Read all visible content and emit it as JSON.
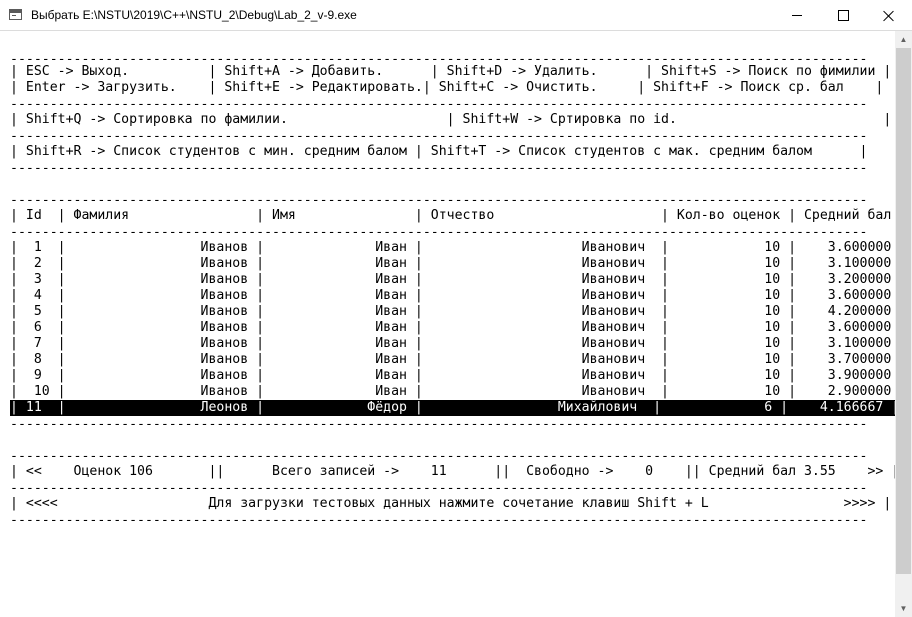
{
  "window": {
    "title": "Выбрать E:\\NSTU\\2019\\C++\\NSTU_2\\Debug\\Lab_2_v-9.exe",
    "icon": "console-app-icon"
  },
  "console": {
    "lines": [
      "------------------------------------------------------------------------------------------------------------",
      "| ESC -> Выход.          | Shift+A -> Добавить.      | Shift+D -> Удалить.      | Shift+S -> Поиск по фимилии |",
      "| Enter -> Загрузить.    | Shift+E -> Редактировать.| Shift+C -> Очистить.     | Shift+F -> Поиск ср. бал    |",
      "------------------------------------------------------------------------------------------------------------",
      "| Shift+Q -> Сортировка по фамилии.                    | Shift+W -> Сртировка по id.                          |",
      "------------------------------------------------------------------------------------------------------------",
      "| Shift+R -> Список студентов с мин. средним балом | Shift+T -> Список студентов с мак. средним балом      |",
      "------------------------------------------------------------------------------------------------------------",
      "",
      "------------------------------------------------------------------------------------------------------------",
      "| Id  | Фамилия                | Имя               | Отчество                     | Кол-во оценок | Средний бал |",
      "------------------------------------------------------------------------------------------------------------",
      "|  1  |                 Иванов |              Иван |                    Иванович  |            10 |    3.600000 |",
      "|  2  |                 Иванов |              Иван |                    Иванович  |            10 |    3.100000 |",
      "|  3  |                 Иванов |              Иван |                    Иванович  |            10 |    3.200000 |",
      "|  4  |                 Иванов |              Иван |                    Иванович  |            10 |    3.600000 |",
      "|  5  |                 Иванов |              Иван |                    Иванович  |            10 |    4.200000 |",
      "|  6  |                 Иванов |              Иван |                    Иванович  |            10 |    3.600000 |",
      "|  7  |                 Иванов |              Иван |                    Иванович  |            10 |    3.100000 |",
      "|  8  |                 Иванов |              Иван |                    Иванович  |            10 |    3.700000 |",
      "|  9  |                 Иванов |              Иван |                    Иванович  |            10 |    3.900000 |",
      "|  10 |                 Иванов |              Иван |                    Иванович  |            10 |    2.900000 |",
      "| 11  |                 Леонов |             Фёдор |                 Михайлович  |             6 |    4.166667 |",
      "------------------------------------------------------------------------------------------------------------",
      "",
      "------------------------------------------------------------------------------------------------------------",
      "| <<    Оценок 106       ||      Всего записей ->    11      ||  Свободно ->    0    || Средний бал 3.55    >> |",
      "------------------------------------------------------------------------------------------------------------",
      "| <<<<                   Для загрузки тестовых данных нажмите сочетание клавиш Shift + L                 >>>> |",
      "------------------------------------------------------------------------------------------------------------"
    ],
    "selected_row": "11"
  }
}
